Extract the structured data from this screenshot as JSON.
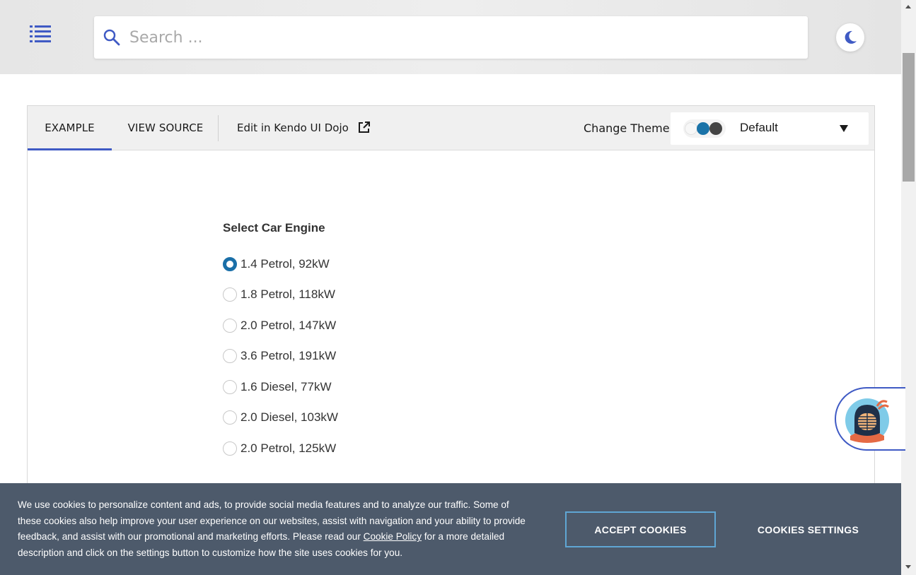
{
  "header": {
    "menu_icon": "list-menu-icon",
    "search_placeholder": "Search ...",
    "theme_toggle_icon": "moon-icon"
  },
  "demo": {
    "tabs": [
      {
        "label": "EXAMPLE",
        "active": true
      },
      {
        "label": "VIEW SOURCE",
        "active": false
      }
    ],
    "dojo_link": "Edit in Kendo UI Dojo",
    "dojo_icon": "external-link-icon",
    "change_theme_label": "Change Theme",
    "theme_value": "Default",
    "theme_swatches": [
      "#f7f7f7",
      "#1a73a8",
      "#444444"
    ],
    "group_title": "Select Car Engine",
    "options": [
      {
        "label": "1.4 Petrol, 92kW",
        "checked": true
      },
      {
        "label": "1.8 Petrol, 118kW",
        "checked": false
      },
      {
        "label": "2.0 Petrol, 147kW",
        "checked": false
      },
      {
        "label": "3.6 Petrol, 191kW",
        "checked": false
      },
      {
        "label": "1.6 Diesel, 77kW",
        "checked": false
      },
      {
        "label": "2.0 Diesel, 103kW",
        "checked": false
      },
      {
        "label": "2.0 Petrol, 125kW",
        "checked": false
      }
    ]
  },
  "cookie": {
    "text_before": "We use cookies to personalize content and ads, to provide social media features and to analyze our traffic. Some of these cookies also help improve your user experience on our websites, assist with navigation and your ability to provide feedback, and assist with our promotional and marketing efforts. Please read our ",
    "link": "Cookie Policy",
    "text_after": " for a more detailed description and click on the settings button to customize how the site uses cookies for you.",
    "accept_label": "ACCEPT COOKIES",
    "settings_label": "COOKIES SETTINGS"
  },
  "colors": {
    "accent": "#3f5ac4",
    "radio_checked": "#1a6fa8",
    "banner_bg": "#4d5a6b",
    "accept_border": "#5fa6d4"
  }
}
